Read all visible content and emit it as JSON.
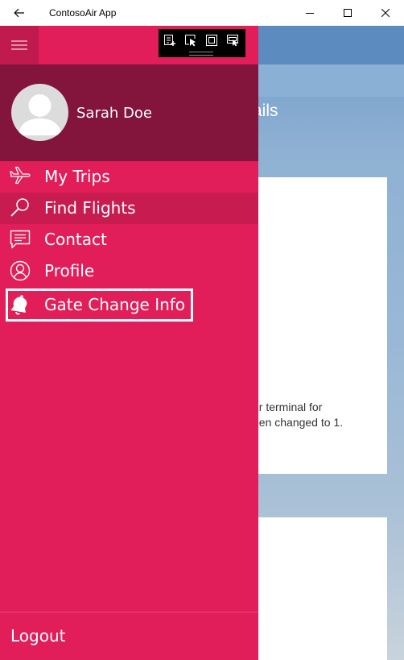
{
  "window": {
    "title": "ContosoAir App"
  },
  "background": {
    "detail_title": "ails",
    "card_line_1": "ur terminal for",
    "card_line_2": "een changed to 1."
  },
  "nav": {
    "user_name": "Sarah Doe",
    "items": [
      {
        "label": "My Trips",
        "icon": "airplane-icon"
      },
      {
        "label": "Find Flights",
        "icon": "search-icon"
      },
      {
        "label": "Contact",
        "icon": "message-icon"
      },
      {
        "label": "Profile",
        "icon": "user-icon"
      },
      {
        "label": "Gate Change Info",
        "icon": "bell-icon"
      }
    ],
    "logout_label": "Logout"
  },
  "colors": {
    "nav_background": "#e11d5a",
    "nav_header_background": "#83143b",
    "selected_item": "#c81c50"
  }
}
